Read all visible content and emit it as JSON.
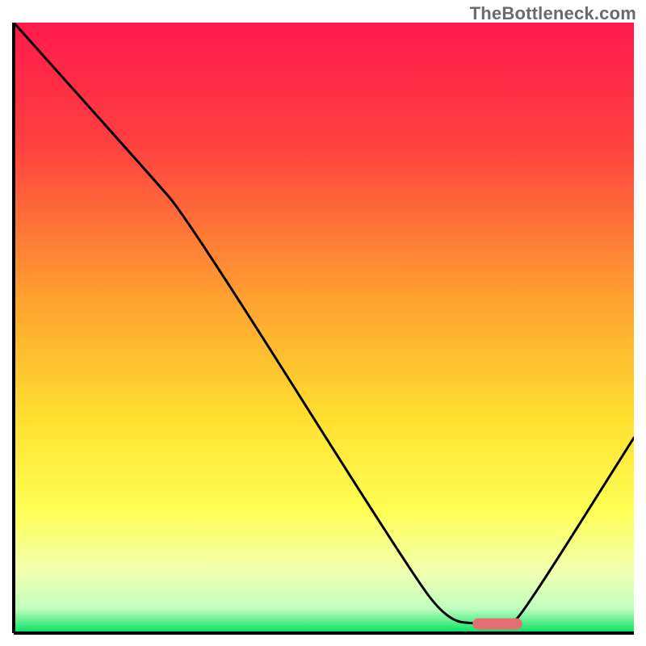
{
  "watermark": "TheBottleneck.com",
  "chart_data": {
    "type": "line",
    "title": "",
    "xlabel": "",
    "ylabel": "",
    "xlim": [
      0,
      100
    ],
    "ylim": [
      0,
      100
    ],
    "gradient_stops": [
      {
        "offset": 0,
        "color": "#ff1a4b"
      },
      {
        "offset": 20,
        "color": "#ff4040"
      },
      {
        "offset": 45,
        "color": "#ffa030"
      },
      {
        "offset": 65,
        "color": "#ffe030"
      },
      {
        "offset": 80,
        "color": "#ffff55"
      },
      {
        "offset": 90,
        "color": "#f0ffb0"
      },
      {
        "offset": 96,
        "color": "#c0ffc0"
      },
      {
        "offset": 100,
        "color": "#00e060"
      }
    ],
    "curve": [
      {
        "x": 0,
        "y": 100
      },
      {
        "x": 22,
        "y": 75
      },
      {
        "x": 28,
        "y": 68
      },
      {
        "x": 64,
        "y": 10
      },
      {
        "x": 70,
        "y": 2
      },
      {
        "x": 75,
        "y": 1.5
      },
      {
        "x": 80,
        "y": 1.5
      },
      {
        "x": 82,
        "y": 3
      },
      {
        "x": 100,
        "y": 32
      }
    ],
    "marker": {
      "x_start": 74,
      "x_end": 82,
      "y": 1.5,
      "color": "#e27070"
    },
    "axis_color": "#000000",
    "curve_color": "#000000"
  }
}
